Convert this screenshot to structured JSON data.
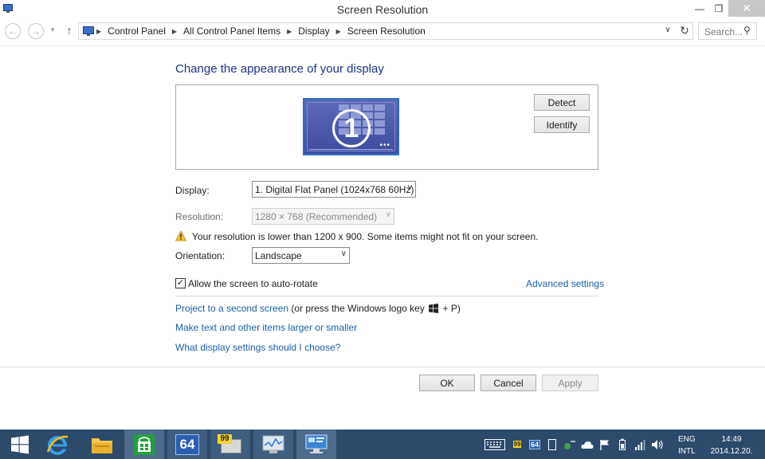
{
  "window": {
    "title": "Screen Resolution",
    "controls": {
      "minimize": "—",
      "maximize": "❐",
      "close": "✕"
    }
  },
  "navigation": {
    "back_icon": "back-arrow-icon",
    "forward_icon": "forward-arrow-icon",
    "up_icon": "up-arrow-icon",
    "breadcrumbs": [
      "Control Panel",
      "All Control Panel Items",
      "Display",
      "Screen Resolution"
    ],
    "search_placeholder": "Search..."
  },
  "main": {
    "heading": "Change the appearance of your display",
    "monitor_number": "1",
    "detect_label": "Detect",
    "identify_label": "Identify",
    "display": {
      "label": "Display:",
      "value": "1. Digital Flat Panel (1024x768 60Hz)"
    },
    "resolution": {
      "label": "Resolution:",
      "value": "1280 × 768 (Recommended)",
      "disabled": true
    },
    "warning": "Your resolution is lower than 1200 x 900. Some items might not fit on your screen.",
    "orientation": {
      "label": "Orientation:",
      "value": "Landscape"
    },
    "auto_rotate": {
      "label": "Allow the screen to auto-rotate",
      "checked": true
    },
    "advanced_link": "Advanced settings",
    "project_link": "Project to a second screen",
    "project_hint_before": "(or press the Windows logo key",
    "project_hint_after": "+ P)",
    "text_size_link": "Make text and other items larger or smaller",
    "help_link": "What display settings should I choose?"
  },
  "footer": {
    "ok": "OK",
    "cancel": "Cancel",
    "apply": "Apply"
  },
  "taskbar": {
    "apps": [
      "start-icon",
      "internet-explorer-icon",
      "file-explorer-icon",
      "store-icon",
      "aida64-icon",
      "cpu-z-icon",
      "resource-monitor-icon",
      "control-panel-icon"
    ],
    "aida_label": "64",
    "cpuz_label": "99",
    "tray_badge_99": "99",
    "tray_badge_64": "64",
    "language": {
      "lang": "ENG",
      "layout": "INTL"
    },
    "clock": {
      "time": "14:49",
      "date": "2014.12.20."
    }
  },
  "colors": {
    "accent": "#1e3287",
    "link": "#1a5fa8",
    "taskbar": "#2d4a6b",
    "monitor": "#3f4c9d"
  }
}
